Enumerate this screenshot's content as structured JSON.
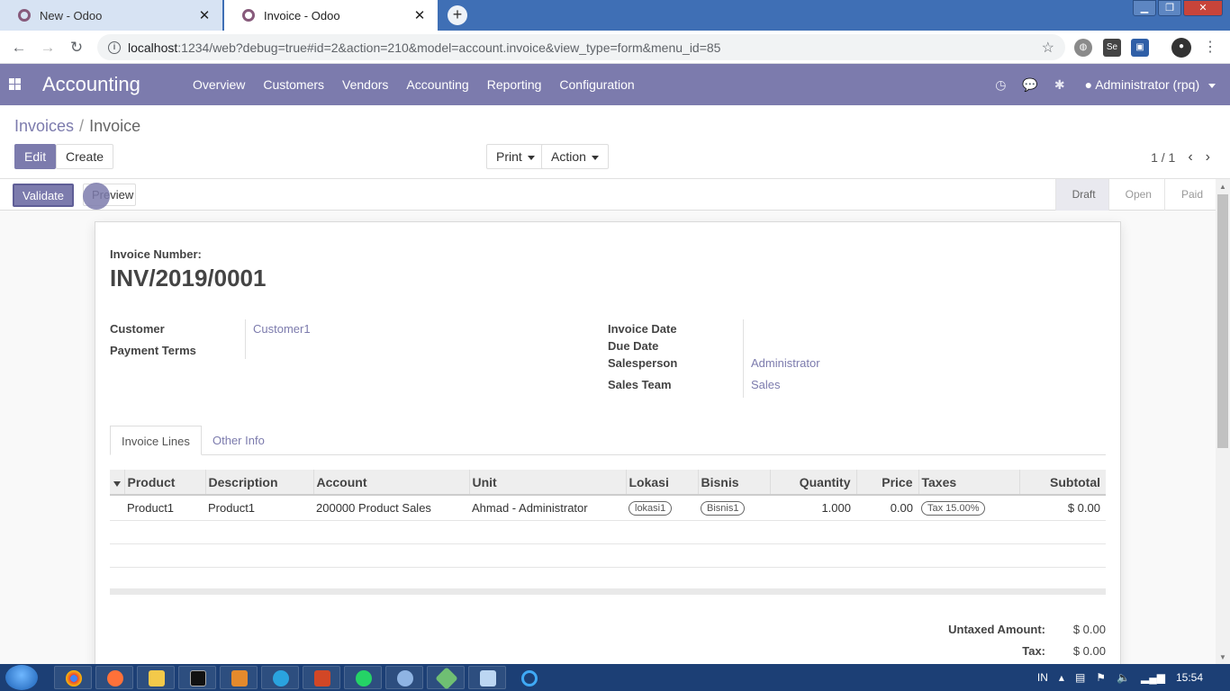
{
  "browser": {
    "tabs": [
      {
        "title": "New - Odoo",
        "active": false
      },
      {
        "title": "Invoice - Odoo",
        "active": true
      }
    ],
    "url_host": "localhost",
    "url_path": ":1234/web?debug=true#id=2&action=210&model=account.invoice&view_type=form&menu_id=85"
  },
  "nav": {
    "app_name": "Accounting",
    "menus": [
      "Overview",
      "Customers",
      "Vendors",
      "Accounting",
      "Reporting",
      "Configuration"
    ],
    "user": "Administrator (rpq)"
  },
  "control_panel": {
    "breadcrumb_parent": "Invoices",
    "breadcrumb_separator": "/",
    "breadcrumb_current": "Invoice",
    "edit_label": "Edit",
    "create_label": "Create",
    "print_label": "Print",
    "action_label": "Action",
    "pager": "1 / 1"
  },
  "statusbar": {
    "validate_label": "Validate",
    "preview_label": "Preview",
    "stages": [
      "Draft",
      "Open",
      "Paid"
    ],
    "current_stage": "Draft"
  },
  "invoice": {
    "number_label": "Invoice Number:",
    "number": "INV/2019/0001",
    "customer_label": "Customer",
    "customer": "Customer1",
    "payment_terms_label": "Payment Terms",
    "invoice_date_label": "Invoice Date",
    "due_date_label": "Due Date",
    "salesperson_label": "Salesperson",
    "salesperson": "Administrator",
    "sales_team_label": "Sales Team",
    "sales_team": "Sales"
  },
  "notebook": {
    "tabs": [
      "Invoice Lines",
      "Other Info"
    ]
  },
  "lines": {
    "headers": [
      "Product",
      "Description",
      "Account",
      "Unit",
      "Lokasi",
      "Bisnis",
      "Quantity",
      "Price",
      "Taxes",
      "Subtotal"
    ],
    "rows": [
      {
        "product": "Product1",
        "description": "Product1",
        "account": "200000 Product Sales",
        "unit": "Ahmad - Administrator",
        "lokasi": "lokasi1",
        "bisnis": "Bisnis1",
        "quantity": "1.000",
        "price": "0.00",
        "taxes": "Tax 15.00%",
        "subtotal": "$ 0.00"
      }
    ]
  },
  "totals": {
    "untaxed_label": "Untaxed Amount:",
    "untaxed": "$ 0.00",
    "tax_label": "Tax:",
    "tax": "$ 0.00"
  },
  "taskbar": {
    "language": "IN",
    "time": "15:54"
  },
  "colors": {
    "brand": "#7c7bad",
    "browser_frame": "#3f6fb5",
    "taskbar": "#1c3f75"
  }
}
